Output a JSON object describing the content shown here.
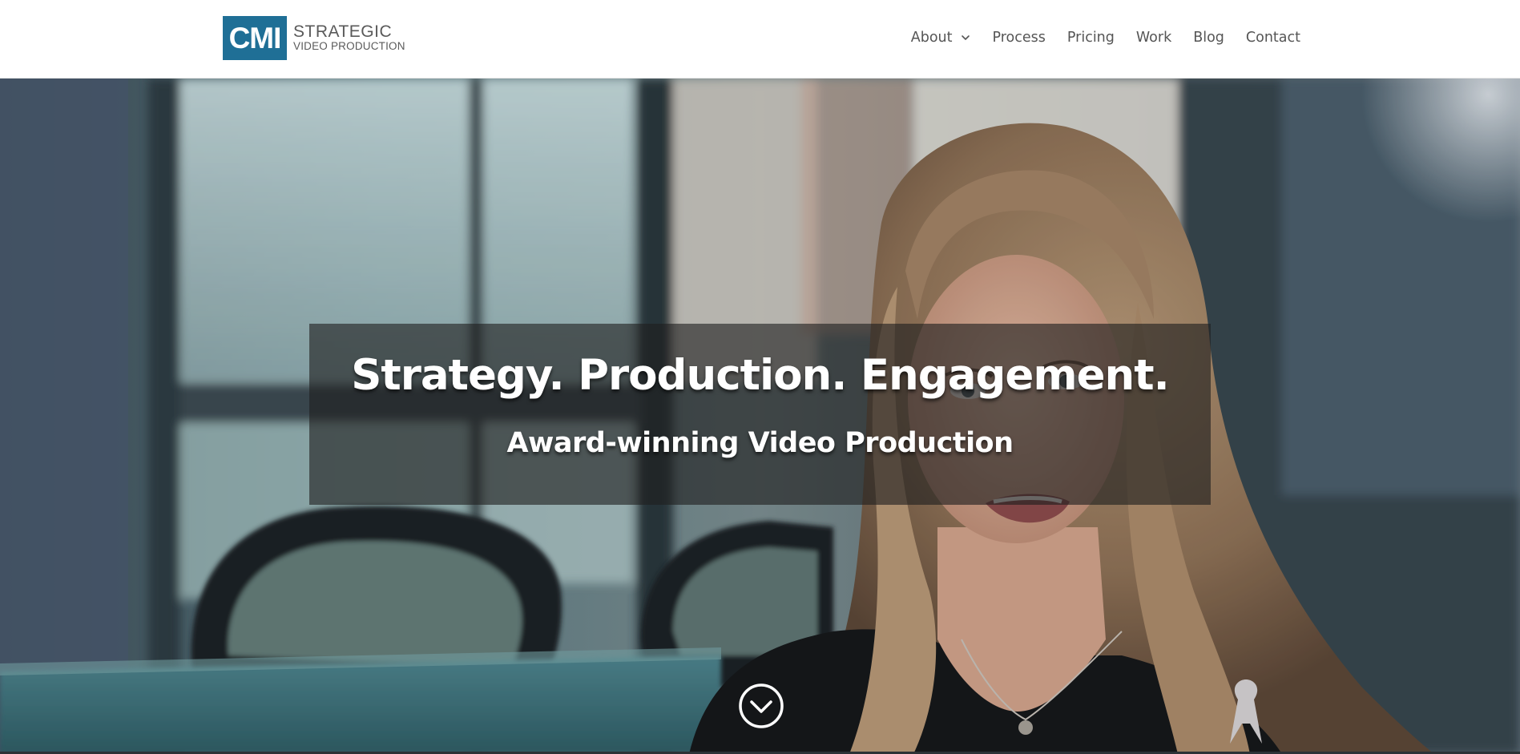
{
  "logo": {
    "mark": "CMI",
    "line1": "STRATEGIC",
    "line2": "VIDEO PRODUCTION",
    "color": "#1f6f96"
  },
  "nav": {
    "items": [
      {
        "label": "About",
        "has_dropdown": true
      },
      {
        "label": "Process"
      },
      {
        "label": "Pricing"
      },
      {
        "label": "Work"
      },
      {
        "label": "Blog"
      },
      {
        "label": "Contact"
      }
    ],
    "dropdown_icon": "chevron-down-icon"
  },
  "hero": {
    "title": "Strategy. Production. Engagement.",
    "subtitle": "Award-winning Video Production",
    "scroll_icon": "circle-chevron-down-icon",
    "background_image": "woman speaking in office interview"
  }
}
